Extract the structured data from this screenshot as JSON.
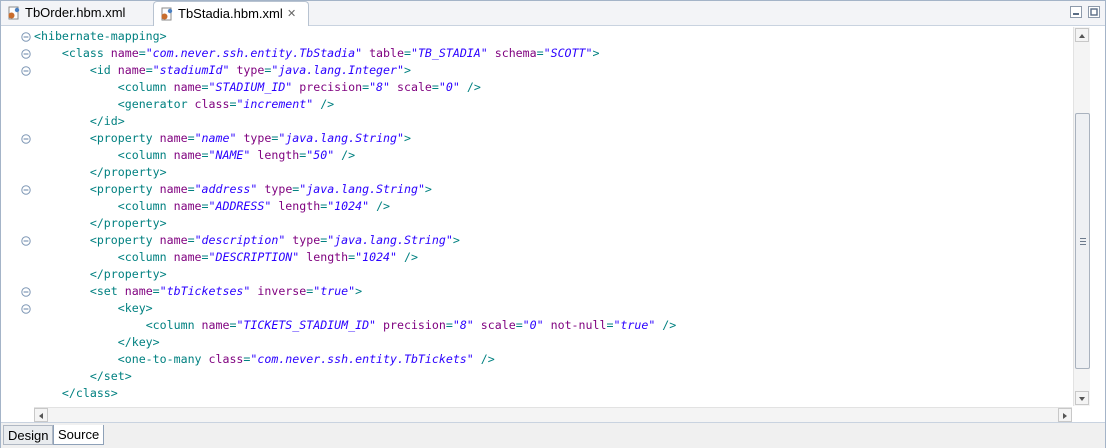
{
  "tabs": [
    {
      "label": "TbOrder.hbm.xml",
      "icon": "xml-file-icon",
      "active": false
    },
    {
      "label": "TbStadia.hbm.xml",
      "icon": "xml-file-icon",
      "active": true,
      "close_icon": "close-icon"
    }
  ],
  "window_controls": {
    "minimize_icon": "minimize-icon",
    "maximize_icon": "maximize-icon"
  },
  "bottom_tabs": [
    {
      "label": "Design",
      "active": false
    },
    {
      "label": "Source",
      "active": true
    }
  ],
  "colors": {
    "tag": "#008080",
    "attribute_name": "#7f007f",
    "attribute_value": "#2a00ff",
    "fold_marker": "#7e97b5"
  },
  "code_lines": [
    {
      "indent": 0,
      "fold": true,
      "parts": [
        {
          "t": "tg",
          "v": "<hibernate-mapping>"
        }
      ]
    },
    {
      "indent": 1,
      "fold": true,
      "parts": [
        {
          "t": "tg",
          "v": "<class "
        },
        {
          "t": "an",
          "v": "name"
        },
        {
          "t": "tg",
          "v": "="
        },
        {
          "t": "av",
          "v": "\"com.never.ssh.entity.TbStadia\""
        },
        {
          "t": "tg",
          "v": " "
        },
        {
          "t": "an",
          "v": "table"
        },
        {
          "t": "tg",
          "v": "="
        },
        {
          "t": "av",
          "v": "\"TB_STADIA\""
        },
        {
          "t": "tg",
          "v": " "
        },
        {
          "t": "an",
          "v": "schema"
        },
        {
          "t": "tg",
          "v": "="
        },
        {
          "t": "av",
          "v": "\"SCOTT\""
        },
        {
          "t": "tg",
          "v": ">"
        }
      ]
    },
    {
      "indent": 2,
      "fold": true,
      "parts": [
        {
          "t": "tg",
          "v": "<id "
        },
        {
          "t": "an",
          "v": "name"
        },
        {
          "t": "tg",
          "v": "="
        },
        {
          "t": "av",
          "v": "\"stadiumId\""
        },
        {
          "t": "tg",
          "v": " "
        },
        {
          "t": "an",
          "v": "type"
        },
        {
          "t": "tg",
          "v": "="
        },
        {
          "t": "av",
          "v": "\"java.lang.Integer\""
        },
        {
          "t": "tg",
          "v": ">"
        }
      ]
    },
    {
      "indent": 3,
      "fold": false,
      "parts": [
        {
          "t": "tg",
          "v": "<column "
        },
        {
          "t": "an",
          "v": "name"
        },
        {
          "t": "tg",
          "v": "="
        },
        {
          "t": "av",
          "v": "\"STADIUM_ID\""
        },
        {
          "t": "tg",
          "v": " "
        },
        {
          "t": "an",
          "v": "precision"
        },
        {
          "t": "tg",
          "v": "="
        },
        {
          "t": "av",
          "v": "\"8\""
        },
        {
          "t": "tg",
          "v": " "
        },
        {
          "t": "an",
          "v": "scale"
        },
        {
          "t": "tg",
          "v": "="
        },
        {
          "t": "av",
          "v": "\"0\""
        },
        {
          "t": "tg",
          "v": " />"
        }
      ]
    },
    {
      "indent": 3,
      "fold": false,
      "parts": [
        {
          "t": "tg",
          "v": "<generator "
        },
        {
          "t": "an",
          "v": "class"
        },
        {
          "t": "tg",
          "v": "="
        },
        {
          "t": "av",
          "v": "\"increment\""
        },
        {
          "t": "tg",
          "v": " />"
        }
      ]
    },
    {
      "indent": 2,
      "fold": false,
      "parts": [
        {
          "t": "tg",
          "v": "</id>"
        }
      ]
    },
    {
      "indent": 2,
      "fold": true,
      "parts": [
        {
          "t": "tg",
          "v": "<property "
        },
        {
          "t": "an",
          "v": "name"
        },
        {
          "t": "tg",
          "v": "="
        },
        {
          "t": "av",
          "v": "\"name\""
        },
        {
          "t": "tg",
          "v": " "
        },
        {
          "t": "an",
          "v": "type"
        },
        {
          "t": "tg",
          "v": "="
        },
        {
          "t": "av",
          "v": "\"java.lang.String\""
        },
        {
          "t": "tg",
          "v": ">"
        }
      ]
    },
    {
      "indent": 3,
      "fold": false,
      "parts": [
        {
          "t": "tg",
          "v": "<column "
        },
        {
          "t": "an",
          "v": "name"
        },
        {
          "t": "tg",
          "v": "="
        },
        {
          "t": "av",
          "v": "\"NAME\""
        },
        {
          "t": "tg",
          "v": " "
        },
        {
          "t": "an",
          "v": "length"
        },
        {
          "t": "tg",
          "v": "="
        },
        {
          "t": "av",
          "v": "\"50\""
        },
        {
          "t": "tg",
          "v": " />"
        }
      ]
    },
    {
      "indent": 2,
      "fold": false,
      "parts": [
        {
          "t": "tg",
          "v": "</property>"
        }
      ]
    },
    {
      "indent": 2,
      "fold": true,
      "parts": [
        {
          "t": "tg",
          "v": "<property "
        },
        {
          "t": "an",
          "v": "name"
        },
        {
          "t": "tg",
          "v": "="
        },
        {
          "t": "av",
          "v": "\"address\""
        },
        {
          "t": "tg",
          "v": " "
        },
        {
          "t": "an",
          "v": "type"
        },
        {
          "t": "tg",
          "v": "="
        },
        {
          "t": "av",
          "v": "\"java.lang.String\""
        },
        {
          "t": "tg",
          "v": ">"
        }
      ]
    },
    {
      "indent": 3,
      "fold": false,
      "parts": [
        {
          "t": "tg",
          "v": "<column "
        },
        {
          "t": "an",
          "v": "name"
        },
        {
          "t": "tg",
          "v": "="
        },
        {
          "t": "av",
          "v": "\"ADDRESS\""
        },
        {
          "t": "tg",
          "v": " "
        },
        {
          "t": "an",
          "v": "length"
        },
        {
          "t": "tg",
          "v": "="
        },
        {
          "t": "av",
          "v": "\"1024\""
        },
        {
          "t": "tg",
          "v": " />"
        }
      ]
    },
    {
      "indent": 2,
      "fold": false,
      "parts": [
        {
          "t": "tg",
          "v": "</property>"
        }
      ]
    },
    {
      "indent": 2,
      "fold": true,
      "parts": [
        {
          "t": "tg",
          "v": "<property "
        },
        {
          "t": "an",
          "v": "name"
        },
        {
          "t": "tg",
          "v": "="
        },
        {
          "t": "av",
          "v": "\"description\""
        },
        {
          "t": "tg",
          "v": " "
        },
        {
          "t": "an",
          "v": "type"
        },
        {
          "t": "tg",
          "v": "="
        },
        {
          "t": "av",
          "v": "\"java.lang.String\""
        },
        {
          "t": "tg",
          "v": ">"
        }
      ]
    },
    {
      "indent": 3,
      "fold": false,
      "parts": [
        {
          "t": "tg",
          "v": "<column "
        },
        {
          "t": "an",
          "v": "name"
        },
        {
          "t": "tg",
          "v": "="
        },
        {
          "t": "av",
          "v": "\"DESCRIPTION\""
        },
        {
          "t": "tg",
          "v": " "
        },
        {
          "t": "an",
          "v": "length"
        },
        {
          "t": "tg",
          "v": "="
        },
        {
          "t": "av",
          "v": "\"1024\""
        },
        {
          "t": "tg",
          "v": " />"
        }
      ]
    },
    {
      "indent": 2,
      "fold": false,
      "parts": [
        {
          "t": "tg",
          "v": "</property>"
        }
      ]
    },
    {
      "indent": 2,
      "fold": true,
      "parts": [
        {
          "t": "tg",
          "v": "<set "
        },
        {
          "t": "an",
          "v": "name"
        },
        {
          "t": "tg",
          "v": "="
        },
        {
          "t": "av",
          "v": "\"tbTicketses\""
        },
        {
          "t": "tg",
          "v": " "
        },
        {
          "t": "an",
          "v": "inverse"
        },
        {
          "t": "tg",
          "v": "="
        },
        {
          "t": "av",
          "v": "\"true\""
        },
        {
          "t": "tg",
          "v": ">"
        }
      ]
    },
    {
      "indent": 3,
      "fold": true,
      "parts": [
        {
          "t": "tg",
          "v": "<key>"
        }
      ]
    },
    {
      "indent": 4,
      "fold": false,
      "parts": [
        {
          "t": "tg",
          "v": "<column "
        },
        {
          "t": "an",
          "v": "name"
        },
        {
          "t": "tg",
          "v": "="
        },
        {
          "t": "av",
          "v": "\"TICKETS_STADIUM_ID\""
        },
        {
          "t": "tg",
          "v": " "
        },
        {
          "t": "an",
          "v": "precision"
        },
        {
          "t": "tg",
          "v": "="
        },
        {
          "t": "av",
          "v": "\"8\""
        },
        {
          "t": "tg",
          "v": " "
        },
        {
          "t": "an",
          "v": "scale"
        },
        {
          "t": "tg",
          "v": "="
        },
        {
          "t": "av",
          "v": "\"0\""
        },
        {
          "t": "tg",
          "v": " "
        },
        {
          "t": "an",
          "v": "not-null"
        },
        {
          "t": "tg",
          "v": "="
        },
        {
          "t": "av",
          "v": "\"true\""
        },
        {
          "t": "tg",
          "v": " />"
        }
      ]
    },
    {
      "indent": 3,
      "fold": false,
      "parts": [
        {
          "t": "tg",
          "v": "</key>"
        }
      ]
    },
    {
      "indent": 3,
      "fold": false,
      "parts": [
        {
          "t": "tg",
          "v": "<one-to-many "
        },
        {
          "t": "an",
          "v": "class"
        },
        {
          "t": "tg",
          "v": "="
        },
        {
          "t": "av",
          "v": "\"com.never.ssh.entity.TbTickets\""
        },
        {
          "t": "tg",
          "v": " />"
        }
      ]
    },
    {
      "indent": 2,
      "fold": false,
      "parts": [
        {
          "t": "tg",
          "v": "</set>"
        }
      ]
    },
    {
      "indent": 1,
      "fold": false,
      "parts": [
        {
          "t": "tg",
          "v": "</class>"
        }
      ]
    }
  ]
}
